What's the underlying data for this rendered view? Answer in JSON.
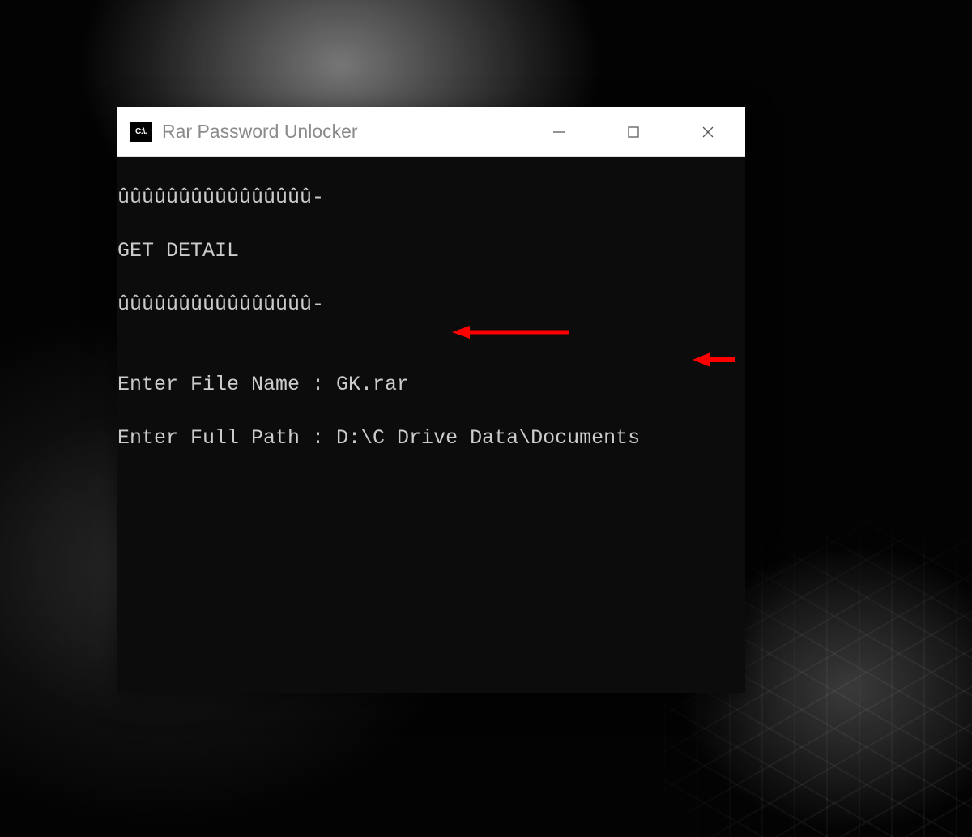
{
  "window": {
    "title": "Rar Password Unlocker",
    "icon_label": "C:\\."
  },
  "terminal": {
    "lines": [
      "ûûûûûûûûûûûûûûûû-",
      "GET DETAIL",
      "ûûûûûûûûûûûûûûûû-",
      "",
      "Enter File Name : GK.rar",
      "Enter Full Path : D:\\C Drive Data\\Documents"
    ]
  },
  "annotations": {
    "arrow_color": "#ff0000"
  }
}
